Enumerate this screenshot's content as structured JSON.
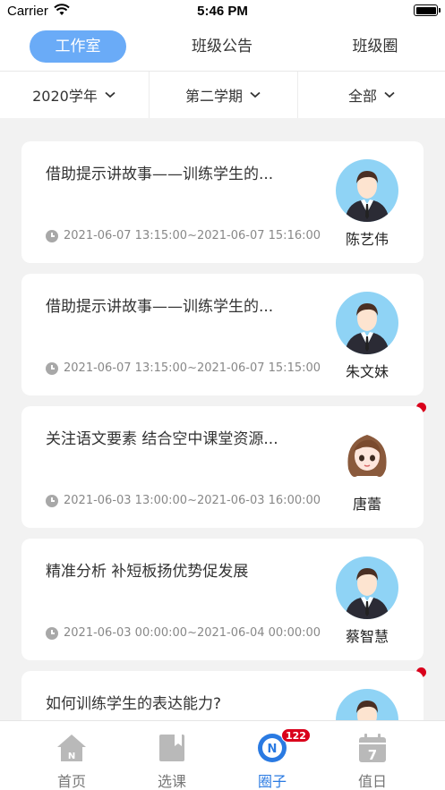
{
  "status_bar": {
    "carrier": "Carrier",
    "time": "5:46 PM"
  },
  "top_tabs": [
    "工作室",
    "班级公告",
    "班级圈"
  ],
  "filters": [
    "2020学年",
    "第二学期",
    "全部"
  ],
  "cards": [
    {
      "title": "借助提示讲故事——训练学生的...",
      "time": "2021-06-07 13:15:00~2021-06-07 15:16:00",
      "author": "陈艺伟",
      "unread": false
    },
    {
      "title": "借助提示讲故事——训练学生的...",
      "time": "2021-06-07 13:15:00~2021-06-07 15:15:00",
      "author": "朱文妹",
      "unread": false
    },
    {
      "title": "关注语文要素 结合空中课堂资源...",
      "time": "2021-06-03 13:00:00~2021-06-03 16:00:00",
      "author": "唐蕾",
      "unread": true
    },
    {
      "title": "精准分析  补短板扬优势促发展",
      "time": "2021-06-03 00:00:00~2021-06-04 00:00:00",
      "author": "蔡智慧",
      "unread": false
    },
    {
      "title": "如何训练学生的表达能力?",
      "time": "",
      "author": "",
      "unread": true
    }
  ],
  "bottom_nav": [
    {
      "label": "首页",
      "icon": "home-icon"
    },
    {
      "label": "选课",
      "icon": "course-icon"
    },
    {
      "label": "圈子",
      "icon": "circle-icon",
      "badge": "122"
    },
    {
      "label": "值日",
      "icon": "calendar-icon",
      "calendar_day": "7"
    }
  ],
  "colors": {
    "accent": "#6aabf7",
    "active_nav": "#2a7ae2",
    "badge": "#d9001b"
  }
}
